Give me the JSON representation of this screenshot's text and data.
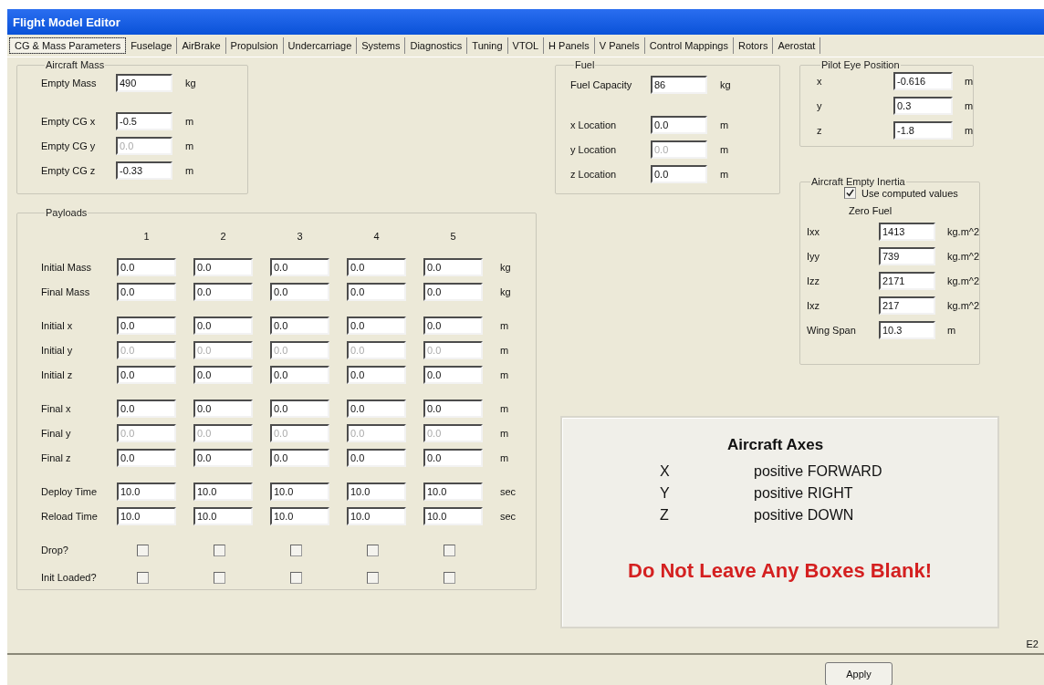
{
  "window": {
    "title": "Flight Model Editor"
  },
  "tabs": [
    {
      "label": "CG & Mass Parameters",
      "selected": true
    },
    {
      "label": "Fuselage",
      "selected": false
    },
    {
      "label": "AirBrake",
      "selected": false
    },
    {
      "label": "Propulsion",
      "selected": false
    },
    {
      "label": "Undercarriage",
      "selected": false
    },
    {
      "label": "Systems",
      "selected": false
    },
    {
      "label": "Diagnostics",
      "selected": false
    },
    {
      "label": "Tuning",
      "selected": false
    },
    {
      "label": "VTOL",
      "selected": false
    },
    {
      "label": "H Panels",
      "selected": false
    },
    {
      "label": "V Panels",
      "selected": false
    },
    {
      "label": "Control Mappings",
      "selected": false
    },
    {
      "label": "Rotors",
      "selected": false
    },
    {
      "label": "Aerostat",
      "selected": false
    }
  ],
  "aircraft_mass": {
    "title": "Aircraft Mass",
    "field_groups": [
      [
        {
          "label": "Empty Mass",
          "value": "490",
          "unit": "kg",
          "disabled": false
        }
      ],
      [
        {
          "label": "Empty CG x",
          "value": "-0.5",
          "unit": "m",
          "disabled": false
        },
        {
          "label": "Empty CG y",
          "value": "0.0",
          "unit": "m",
          "disabled": true
        },
        {
          "label": "Empty CG z",
          "value": "-0.33",
          "unit": "m",
          "disabled": false
        }
      ]
    ]
  },
  "payloads": {
    "title": "Payloads",
    "columns": [
      "1",
      "2",
      "3",
      "4",
      "5"
    ],
    "row_groups": [
      [
        {
          "kind": "fields",
          "label": "Initial Mass",
          "unit": "kg",
          "cells": [
            {
              "value": "0.0",
              "disabled": false
            },
            {
              "value": "0.0",
              "disabled": false
            },
            {
              "value": "0.0",
              "disabled": false
            },
            {
              "value": "0.0",
              "disabled": false
            },
            {
              "value": "0.0",
              "disabled": false
            }
          ]
        },
        {
          "kind": "fields",
          "label": "Final Mass",
          "unit": "kg",
          "cells": [
            {
              "value": "0.0",
              "disabled": false
            },
            {
              "value": "0.0",
              "disabled": false
            },
            {
              "value": "0.0",
              "disabled": false
            },
            {
              "value": "0.0",
              "disabled": false
            },
            {
              "value": "0.0",
              "disabled": false
            }
          ]
        }
      ],
      [
        {
          "kind": "fields",
          "label": "Initial x",
          "unit": "m",
          "cells": [
            {
              "value": "0.0",
              "disabled": false
            },
            {
              "value": "0.0",
              "disabled": false
            },
            {
              "value": "0.0",
              "disabled": false
            },
            {
              "value": "0.0",
              "disabled": false
            },
            {
              "value": "0.0",
              "disabled": false
            }
          ]
        },
        {
          "kind": "fields",
          "label": "Initial y",
          "unit": "m",
          "cells": [
            {
              "value": "0.0",
              "disabled": true
            },
            {
              "value": "0.0",
              "disabled": true
            },
            {
              "value": "0.0",
              "disabled": true
            },
            {
              "value": "0.0",
              "disabled": true
            },
            {
              "value": "0.0",
              "disabled": true
            }
          ]
        },
        {
          "kind": "fields",
          "label": "Initial z",
          "unit": "m",
          "cells": [
            {
              "value": "0.0",
              "disabled": false
            },
            {
              "value": "0.0",
              "disabled": false
            },
            {
              "value": "0.0",
              "disabled": false
            },
            {
              "value": "0.0",
              "disabled": false
            },
            {
              "value": "0.0",
              "disabled": false
            }
          ]
        }
      ],
      [
        {
          "kind": "fields",
          "label": "Final x",
          "unit": "m",
          "cells": [
            {
              "value": "0.0",
              "disabled": false
            },
            {
              "value": "0.0",
              "disabled": false
            },
            {
              "value": "0.0",
              "disabled": false
            },
            {
              "value": "0.0",
              "disabled": false
            },
            {
              "value": "0.0",
              "disabled": false
            }
          ]
        },
        {
          "kind": "fields",
          "label": "Final y",
          "unit": "m",
          "cells": [
            {
              "value": "0.0",
              "disabled": true
            },
            {
              "value": "0.0",
              "disabled": true
            },
            {
              "value": "0.0",
              "disabled": true
            },
            {
              "value": "0.0",
              "disabled": true
            },
            {
              "value": "0.0",
              "disabled": true
            }
          ]
        },
        {
          "kind": "fields",
          "label": "Final z",
          "unit": "m",
          "cells": [
            {
              "value": "0.0",
              "disabled": false
            },
            {
              "value": "0.0",
              "disabled": false
            },
            {
              "value": "0.0",
              "disabled": false
            },
            {
              "value": "0.0",
              "disabled": false
            },
            {
              "value": "0.0",
              "disabled": false
            }
          ]
        }
      ],
      [
        {
          "kind": "fields",
          "label": "Deploy Time",
          "unit": "sec",
          "cells": [
            {
              "value": "10.0",
              "disabled": false
            },
            {
              "value": "10.0",
              "disabled": false
            },
            {
              "value": "10.0",
              "disabled": false
            },
            {
              "value": "10.0",
              "disabled": false
            },
            {
              "value": "10.0",
              "disabled": false
            }
          ]
        },
        {
          "kind": "fields",
          "label": "Reload Time",
          "unit": "sec",
          "cells": [
            {
              "value": "10.0",
              "disabled": false
            },
            {
              "value": "10.0",
              "disabled": false
            },
            {
              "value": "10.0",
              "disabled": false
            },
            {
              "value": "10.0",
              "disabled": false
            },
            {
              "value": "10.0",
              "disabled": false
            }
          ]
        }
      ],
      [
        {
          "kind": "checkboxes",
          "label": "Drop?",
          "cells": [
            {
              "checked": false
            },
            {
              "checked": false
            },
            {
              "checked": false
            },
            {
              "checked": false
            },
            {
              "checked": false
            }
          ]
        },
        {
          "kind": "checkboxes",
          "label": "Init Loaded?",
          "cells": [
            {
              "checked": false
            },
            {
              "checked": false
            },
            {
              "checked": false
            },
            {
              "checked": false
            },
            {
              "checked": false
            }
          ]
        }
      ]
    ]
  },
  "fuel": {
    "title": "Fuel",
    "field_groups": [
      [
        {
          "label": "Fuel Capacity",
          "value": "86",
          "unit": "kg",
          "disabled": false
        }
      ],
      [
        {
          "label": "x Location",
          "value": "0.0",
          "unit": "m",
          "disabled": false
        },
        {
          "label": "y Location",
          "value": "0.0",
          "unit": "m",
          "disabled": true
        },
        {
          "label": "z Location",
          "value": "0.0",
          "unit": "m",
          "disabled": false
        }
      ]
    ]
  },
  "pilot_eye_position": {
    "title": "Pilot Eye Position",
    "fields": [
      {
        "label": "x",
        "value": "-0.616",
        "unit": "m",
        "disabled": false
      },
      {
        "label": "y",
        "value": "0.3",
        "unit": "m",
        "disabled": false
      },
      {
        "label": "z",
        "value": "-1.8",
        "unit": "m",
        "disabled": false
      }
    ]
  },
  "aircraft_empty_inertia": {
    "title": "Aircraft Empty Inertia",
    "checkbox": {
      "label": "Use computed values",
      "checked": true
    },
    "subheading": "Zero Fuel",
    "fields": [
      {
        "label": "Ixx",
        "value": "1413",
        "unit": "kg.m^2",
        "disabled": false
      },
      {
        "label": "Iyy",
        "value": "739",
        "unit": "kg.m^2",
        "disabled": false
      },
      {
        "label": "Izz",
        "value": "2171",
        "unit": "kg.m^2",
        "disabled": false
      },
      {
        "label": "Ixz",
        "value": "217",
        "unit": "kg.m^2",
        "disabled": false
      },
      {
        "label": "Wing Span",
        "value": "10.3",
        "unit": "m",
        "disabled": false
      }
    ]
  },
  "axes_note": {
    "title": "Aircraft Axes",
    "axes": [
      {
        "axis": "X",
        "direction": "positive FORWARD"
      },
      {
        "axis": "Y",
        "direction": "positive RIGHT"
      },
      {
        "axis": "Z",
        "direction": "positive DOWN"
      }
    ],
    "warning": "Do Not Leave Any Boxes Blank!"
  },
  "corner_label": "E2",
  "buttons": [
    {
      "label": "Apply"
    }
  ]
}
